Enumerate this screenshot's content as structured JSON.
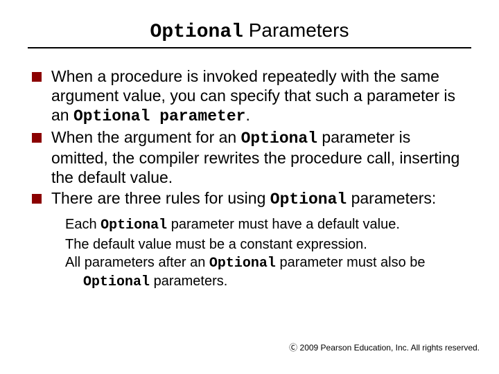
{
  "title": {
    "mono": "Optional",
    "rest": " Parameters"
  },
  "bullets": [
    {
      "parts": [
        {
          "t": "When a procedure is invoked repeatedly with the same argument value, you can specify that such a parameter is an ",
          "mono": false
        },
        {
          "t": "Optional parameter",
          "mono": true
        },
        {
          "t": ".",
          "mono": false
        }
      ]
    },
    {
      "parts": [
        {
          "t": "When the argument for an ",
          "mono": false
        },
        {
          "t": "Optional",
          "mono": true
        },
        {
          "t": " parameter is omitted, the compiler rewrites the procedure call, inserting the default value.",
          "mono": false
        }
      ]
    },
    {
      "parts": [
        {
          "t": "There are three rules for using ",
          "mono": false
        },
        {
          "t": "Optional",
          "mono": true
        },
        {
          "t": " parameters:",
          "mono": false
        }
      ]
    }
  ],
  "sub_bullets": [
    {
      "parts": [
        {
          "t": "Each ",
          "mono": false
        },
        {
          "t": "Optional",
          "mono": true
        },
        {
          "t": " parameter must have a default value.",
          "mono": false
        }
      ]
    },
    {
      "parts": [
        {
          "t": "The default value must be a constant expression.",
          "mono": false
        }
      ]
    },
    {
      "parts": [
        {
          "t": "All parameters after an ",
          "mono": false
        },
        {
          "t": "Optional",
          "mono": true
        },
        {
          "t": " parameter must also be ",
          "mono": false
        },
        {
          "t": "Optional",
          "mono": true
        },
        {
          "t": " parameters.",
          "mono": false
        }
      ]
    }
  ],
  "footer": "2009 Pearson Education, Inc.  All rights reserved."
}
